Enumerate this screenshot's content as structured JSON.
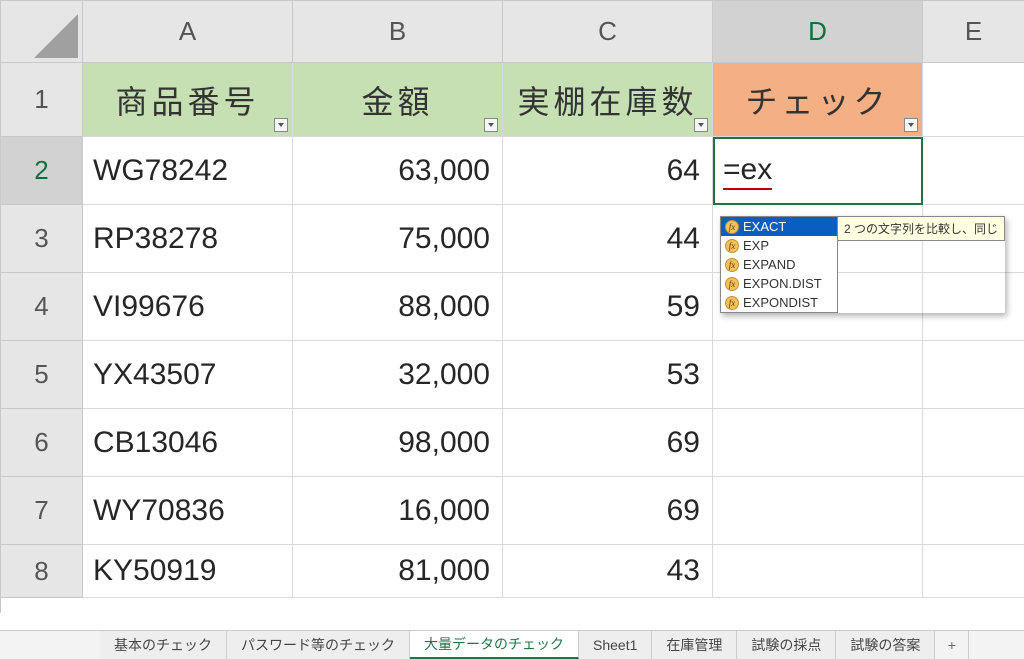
{
  "columns": [
    "A",
    "B",
    "C",
    "D",
    "E"
  ],
  "rowNumbers": [
    "1",
    "2",
    "3",
    "4",
    "5",
    "6",
    "7",
    "8"
  ],
  "headers": {
    "A": "商品番号",
    "B": "金額",
    "C": "実棚在庫数",
    "D": "チェック"
  },
  "rows": [
    {
      "A": "WG78242",
      "B": "63,000",
      "C": "64"
    },
    {
      "A": "RP38278",
      "B": "75,000",
      "C": "44"
    },
    {
      "A": "VI99676",
      "B": "88,000",
      "C": "59"
    },
    {
      "A": "YX43507",
      "B": "32,000",
      "C": "53"
    },
    {
      "A": "CB13046",
      "B": "98,000",
      "C": "69"
    },
    {
      "A": "WY70836",
      "B": "16,000",
      "C": "69"
    },
    {
      "A": "KY50919",
      "B": "81,000",
      "C": "43"
    }
  ],
  "editingCell": {
    "address": "D2",
    "value": "=ex"
  },
  "autocomplete": {
    "items": [
      "EXACT",
      "EXP",
      "EXPAND",
      "EXPON.DIST",
      "EXPONDIST"
    ],
    "selectedIndex": 0,
    "tooltip": "2 つの文字列を比較し、同じ"
  },
  "sheetTabs": {
    "items": [
      "基本のチェック",
      "パスワード等のチェック",
      "大量データのチェック",
      "Sheet1",
      "在庫管理",
      "試験の採点",
      "試験の答案"
    ],
    "active": "大量データのチェック",
    "newSheetGlyph": "+"
  }
}
